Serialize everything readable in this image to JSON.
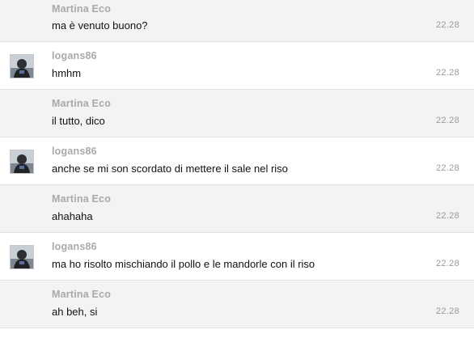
{
  "colors": {
    "alt_row": "#f3f3f3",
    "sender": "#a9a9a9",
    "text": "#111111",
    "time": "#9a9a9a"
  },
  "messages": [
    {
      "sender": "Martina Eco",
      "text": "ma è venuto buono?",
      "time": "22.28",
      "avatar": ""
    },
    {
      "sender": "logans86",
      "text": "hmhm",
      "time": "22.28",
      "avatar": "user-avatar-icon"
    },
    {
      "sender": "Martina Eco",
      "text": "il tutto, dico",
      "time": "22.28",
      "avatar": ""
    },
    {
      "sender": "logans86",
      "text": "anche se mi son scordato di mettere il sale nel riso",
      "time": "22.28",
      "avatar": "user-avatar-icon"
    },
    {
      "sender": "Martina Eco",
      "text": "ahahaha",
      "time": "22.28",
      "avatar": ""
    },
    {
      "sender": "logans86",
      "text": "ma ho risolto mischiando il pollo e le mandorle con il riso",
      "time": "22.28",
      "avatar": "user-avatar-icon"
    },
    {
      "sender": "Martina Eco",
      "text": "ah beh, si",
      "time": "22.28",
      "avatar": ""
    }
  ]
}
